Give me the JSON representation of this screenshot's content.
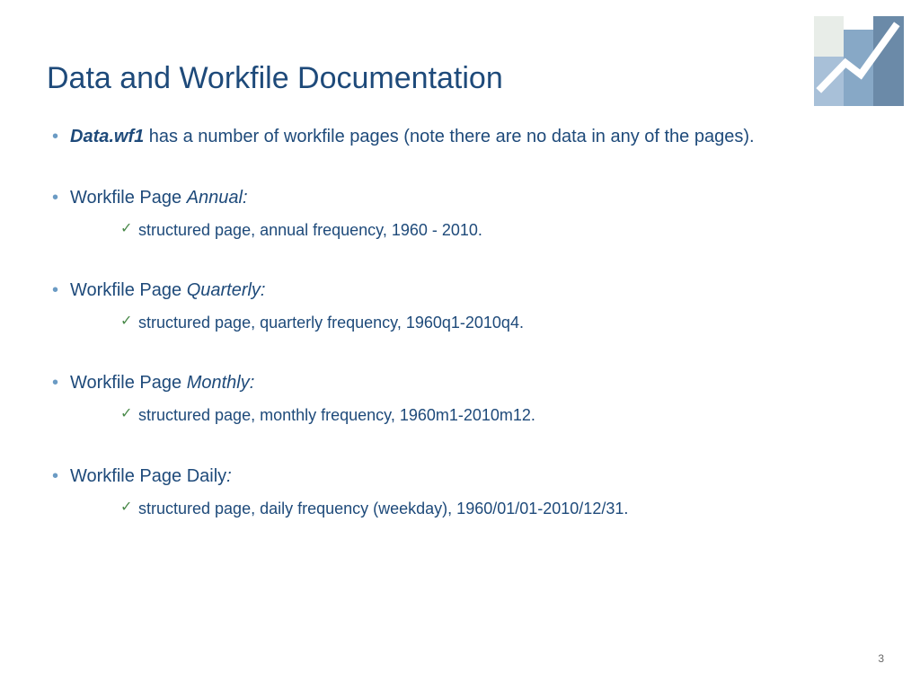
{
  "title": "Data and Workfile Documentation",
  "items": [
    {
      "prefix": "Data.wf1",
      "prefixStyle": "bold-italic",
      "text": " has a number of workfile pages (note there are no data in any of the pages).",
      "sub": null
    },
    {
      "prefix": "Workfile Page ",
      "suffix": "Annual:",
      "suffixStyle": "italic",
      "sub": "structured page, annual frequency, 1960 - 2010."
    },
    {
      "prefix": "Workfile Page ",
      "suffix": "Quarterly:",
      "suffixStyle": "italic",
      "sub": "structured page, quarterly frequency, 1960q1-2010q4."
    },
    {
      "prefix": "Workfile Page ",
      "suffix": "Monthly:",
      "suffixStyle": "italic",
      "sub": "structured page, monthly frequency, 1960m1-2010m12."
    },
    {
      "prefix": "Workfile Page Daily",
      "suffix": ":",
      "suffixStyle": "italic",
      "sub": "structured page, daily frequency (weekday), 1960/01/01-2010/12/31."
    }
  ],
  "pageNumber": "3"
}
